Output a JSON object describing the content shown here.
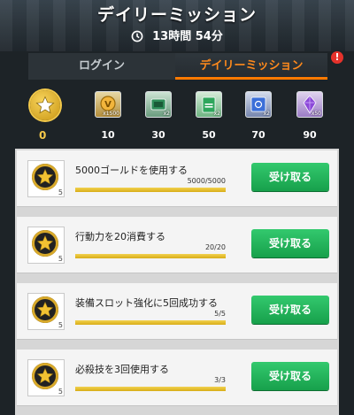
{
  "header": {
    "title": "デイリーミッション",
    "timer": "13時間 54分"
  },
  "tabs": [
    {
      "label": "ログイン",
      "active": false
    },
    {
      "label": "デイリーミッション",
      "active": true
    }
  ],
  "alert_badge": "!",
  "progress": {
    "current": "0",
    "milestones": [
      {
        "value": "10",
        "reward_count": "x1500",
        "color": "#f2b53c"
      },
      {
        "value": "30",
        "reward_count": "x2",
        "color": "#2e8c58"
      },
      {
        "value": "50",
        "reward_count": "x2",
        "color": "#2ea65c"
      },
      {
        "value": "70",
        "reward_count": "x2",
        "color": "#3b6fd8"
      },
      {
        "value": "90",
        "reward_count": "x50",
        "color": "#8c49d8"
      }
    ]
  },
  "missions": [
    {
      "title": "5000ゴールドを使用する",
      "progress_text": "5000/5000",
      "progress": 1.0,
      "reward_count": "5",
      "button": "受け取る"
    },
    {
      "title": "行動力を20消費する",
      "progress_text": "20/20",
      "progress": 1.0,
      "reward_count": "5",
      "button": "受け取る"
    },
    {
      "title": "装備スロット強化に5回成功する",
      "progress_text": "5/5",
      "progress": 1.0,
      "reward_count": "5",
      "button": "受け取る"
    },
    {
      "title": "必殺技を3回使用する",
      "progress_text": "3/3",
      "progress": 1.0,
      "reward_count": "5",
      "button": "受け取る"
    }
  ],
  "colors": {
    "accent": "#ff7a00",
    "button": "#1fae57",
    "progress_fill": "#e3b622"
  }
}
